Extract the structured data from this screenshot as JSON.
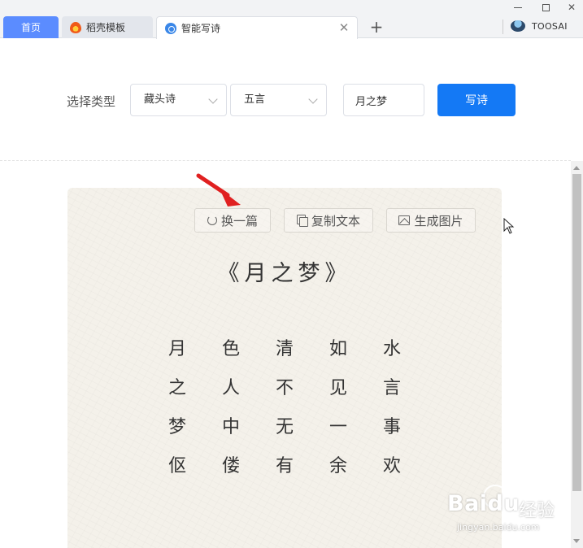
{
  "tabs": {
    "home_label": "首页",
    "template_label": "稻壳模板",
    "active_label": "智能写诗",
    "new_tab": "+"
  },
  "window": {
    "user_name": "TOOSAI"
  },
  "toolbar": {
    "type_label": "选择类型",
    "poem_type": "藏头诗",
    "line_length": "五言",
    "title_value": "月之梦",
    "write_label": "写诗"
  },
  "actions": {
    "refresh_label": "换一篇",
    "copy_label": "复制文本",
    "image_label": "生成图片"
  },
  "poem": {
    "title": "《月之梦》",
    "lines": [
      [
        "月",
        "色",
        "清",
        "如",
        "水"
      ],
      [
        "之",
        "人",
        "不",
        "见",
        "言"
      ],
      [
        "梦",
        "中",
        "无",
        "一",
        "事"
      ],
      [
        "伛",
        "偻",
        "有",
        "余",
        "欢"
      ]
    ]
  },
  "watermark": {
    "logo": "Baidu",
    "sub": "经验",
    "url": "jingyan.baidu.com"
  },
  "colors": {
    "accent": "#1479f5",
    "home_tab": "#5b8cff",
    "card_bg": "#f4f1ea",
    "arrow": "#e02020"
  }
}
